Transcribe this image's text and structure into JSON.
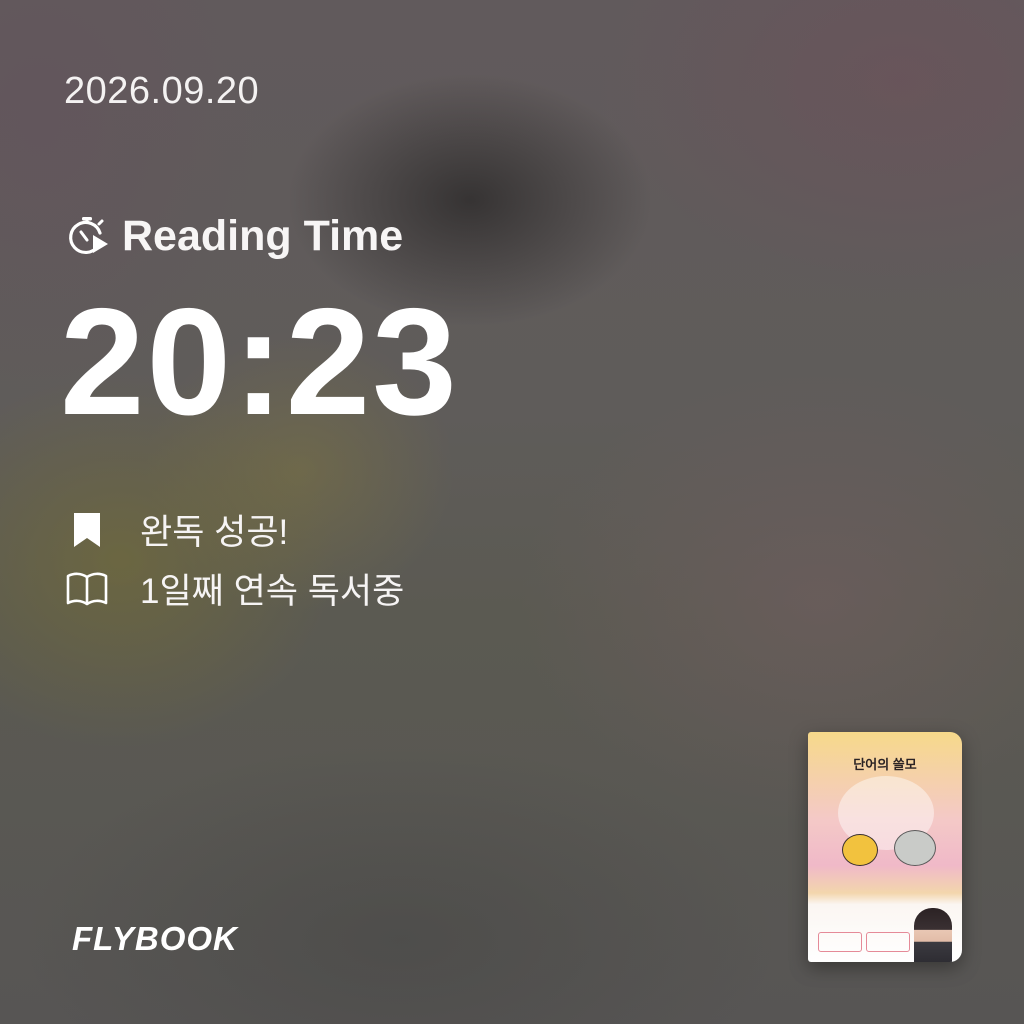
{
  "date": "2026.09.20",
  "reading": {
    "title": "Reading Time",
    "title_icon": "stopwatch-play-icon",
    "time": "20:23"
  },
  "stats": [
    {
      "icon": "bookmark-icon",
      "label": "완독 성공!"
    },
    {
      "icon": "open-book-icon",
      "label": "1일째 연속 독서중"
    }
  ],
  "brand": "FLYBOOK",
  "book": {
    "title": "단어의 쓸모",
    "cover_colors": [
      "#f6d98a",
      "#f0b9c8",
      "#ffffff"
    ]
  },
  "colors": {
    "text": "#ffffff",
    "background": "#5e5a58"
  }
}
